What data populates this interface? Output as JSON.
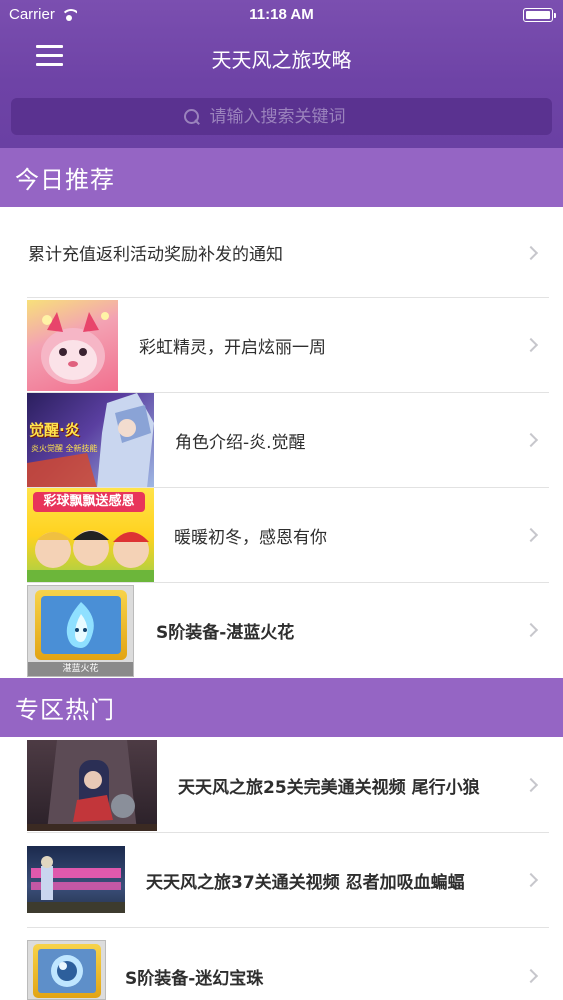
{
  "status_bar": {
    "carrier": "Carrier",
    "time": "11:18 AM"
  },
  "nav": {
    "title": "天天风之旅攻略"
  },
  "search": {
    "placeholder": "请输入搜索关键词"
  },
  "sections": {
    "today": {
      "title": "今日推荐",
      "items": [
        {
          "label": "累计充值返利活动奖励补发的通知"
        },
        {
          "label": "彩虹精灵，开启炫丽一周"
        },
        {
          "label": "角色介绍-炎.觉醒",
          "thumb_text_main": "觉醒·炎",
          "thumb_text_sub": "炎火觉醒 全新技能"
        },
        {
          "label": "暖暖初冬，感恩有你",
          "thumb_text_main": "彩球飘飘送感恩"
        },
        {
          "label": "S阶装备-湛蓝火花",
          "thumb_caption": "湛蓝火花"
        }
      ]
    },
    "hot": {
      "title": "专区热门",
      "items": [
        {
          "label": "天天风之旅25关完美通关视频 尾行小狼"
        },
        {
          "label": "天天风之旅37关通关视频 忍者加吸血蝙蝠"
        },
        {
          "label": "S阶装备-迷幻宝珠"
        }
      ]
    }
  },
  "colors": {
    "header_purple": "#6e43a6",
    "section_purple": "#9565c4",
    "search_bg": "#5a3290"
  }
}
